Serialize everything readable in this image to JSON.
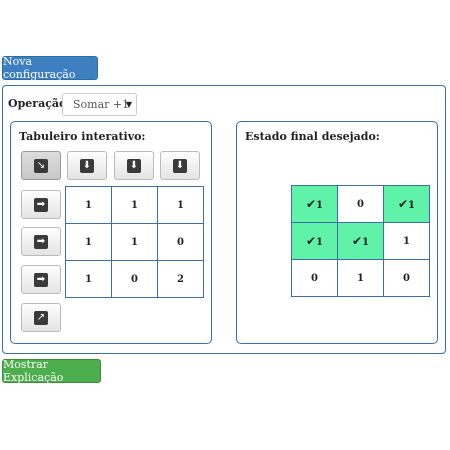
{
  "toolbar": {
    "new_config_label": "Nova configuração"
  },
  "operation": {
    "label": "Operação:",
    "selected": "Somar +1"
  },
  "interactive_board": {
    "title": "Tabuleiro interativo:",
    "top_arrows": [
      "↘",
      "⬇",
      "⬇",
      "⬇"
    ],
    "side_arrows": [
      "➡",
      "➡",
      "➡",
      "↗"
    ],
    "grid": [
      [
        "1",
        "1",
        "1"
      ],
      [
        "1",
        "1",
        "0"
      ],
      [
        "1",
        "0",
        "2"
      ]
    ]
  },
  "target_board": {
    "title": "Estado final desejado:",
    "check_symbol": "✔",
    "grid": [
      [
        {
          "v": "1",
          "ok": true
        },
        {
          "v": "0",
          "ok": false
        },
        {
          "v": "1",
          "ok": true
        }
      ],
      [
        {
          "v": "1",
          "ok": true
        },
        {
          "v": "1",
          "ok": true
        },
        {
          "v": "1",
          "ok": false
        }
      ],
      [
        {
          "v": "0",
          "ok": false
        },
        {
          "v": "1",
          "ok": false
        },
        {
          "v": "0",
          "ok": false
        }
      ]
    ],
    "highlight_color": "#5ff2a8"
  },
  "footer": {
    "show_explanation_label": "Mostrar Explicação"
  }
}
